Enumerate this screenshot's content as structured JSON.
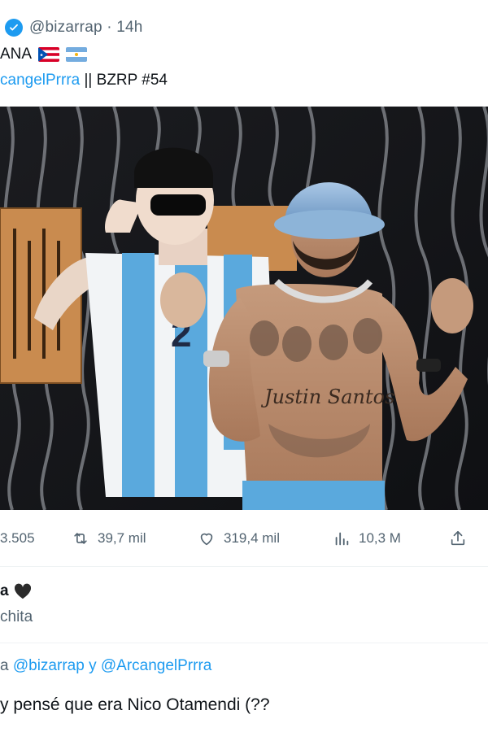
{
  "tweet": {
    "handle": "@bizarrap",
    "time": "· 14h",
    "line2_text": "ANA",
    "line3_link": "cangelPrrra",
    "line3_rest": " || BZRP #54",
    "flags": [
      "puerto-rico-flag",
      "argentina-flag"
    ]
  },
  "photo": {
    "tattoo_text": "Justin Santos",
    "jersey_number": "2"
  },
  "actions": {
    "replies": "3.505",
    "retweets": "39,7 mil",
    "likes": "319,4 mil",
    "views": "10,3 M",
    "icons": [
      "reply-icon",
      "retweet-icon",
      "heart-icon",
      "views-icon",
      "share-icon"
    ]
  },
  "reply1": {
    "name": "a",
    "text": "chita"
  },
  "reply2": {
    "to_prefix": "a ",
    "mention1": "@bizarrap",
    "joiner": " y ",
    "mention2": "@ArcangelPrrra",
    "text": "y pensé que era Nico Otamendi (??"
  },
  "colors": {
    "accent": "#1d9bf0",
    "muted": "#536471",
    "text": "#0f1419"
  }
}
